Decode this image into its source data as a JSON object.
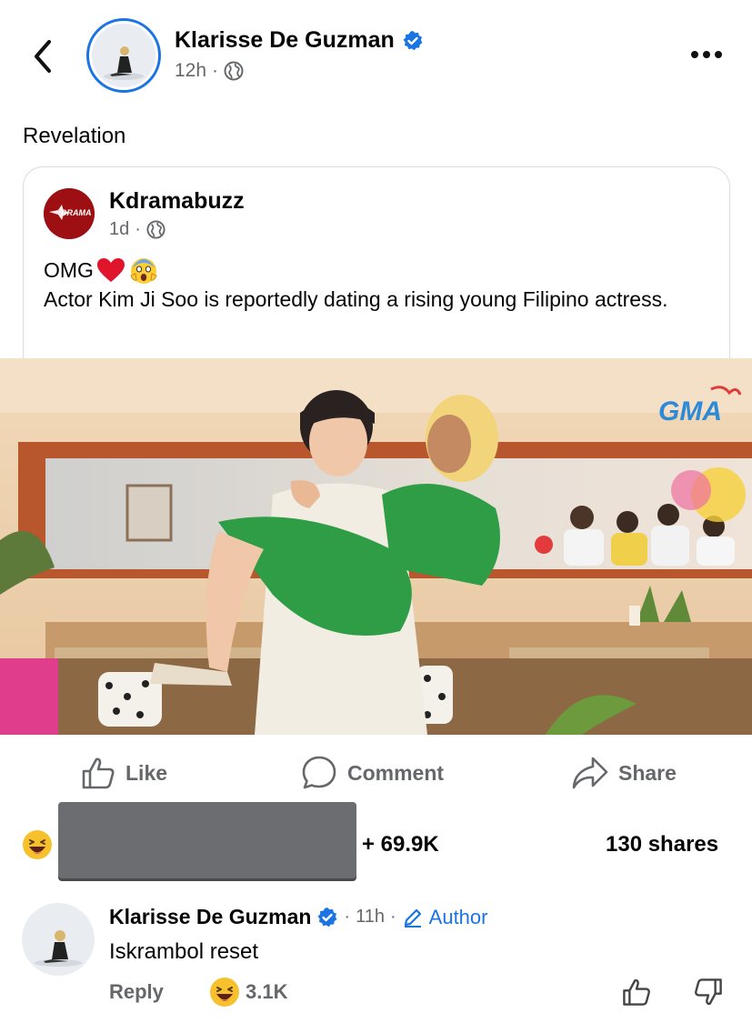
{
  "header": {
    "author_name": "Klarisse De Guzman",
    "time": "12h",
    "dot": "·"
  },
  "caption": "Revelation",
  "shared_post": {
    "page_name": "Kdramabuzz",
    "logo_text": "DRAMA",
    "time": "1d",
    "dot": "·",
    "text_line1": "OMG",
    "text_body": "Actor Kim Ji Soo is reportedly dating a rising young Filipino actress.",
    "photo_watermark": "GMA"
  },
  "actions": {
    "like": "Like",
    "comment": "Comment",
    "share": "Share"
  },
  "stats": {
    "reactions_count": "+ 69.9K",
    "shares": "130 shares"
  },
  "comment": {
    "author": "Klarisse De Guzman",
    "dot1": "·",
    "time": "11h",
    "dot2": "·",
    "author_badge": "Author",
    "text": "Iskrambol reset",
    "reply": "Reply",
    "reaction_count": "3.1K"
  },
  "colors": {
    "accent": "#1b74e4",
    "secondary_text": "#65676b"
  }
}
